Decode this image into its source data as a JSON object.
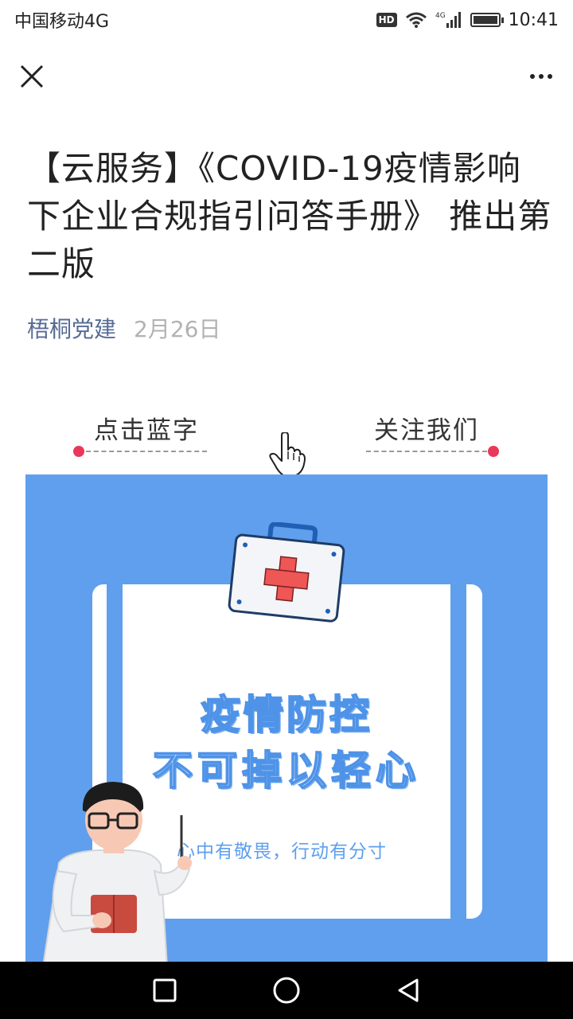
{
  "status_bar": {
    "carrier": "中国移动4G",
    "hd": "HD",
    "network": "4G",
    "time": "10:41"
  },
  "nav": {
    "close_icon": "close-icon",
    "more_icon": "more-icon"
  },
  "article": {
    "title": "【云服务】《COVID-19疫情影响下企业合规指引问答手册》 推出第二版",
    "author": "梧桐党建",
    "date": "2月26日"
  },
  "follow": {
    "left_text": "点击蓝字",
    "right_text": "关注我们",
    "dot_color": "#e8395a"
  },
  "poster": {
    "headline_1": "疫情防控",
    "headline_2": "不可掉以轻心",
    "tagline": "心中有敬畏，行动有分寸",
    "bg_color": "#5f9fee"
  },
  "android_nav": {
    "recent": "square-icon",
    "home": "circle-icon",
    "back": "triangle-back-icon"
  }
}
